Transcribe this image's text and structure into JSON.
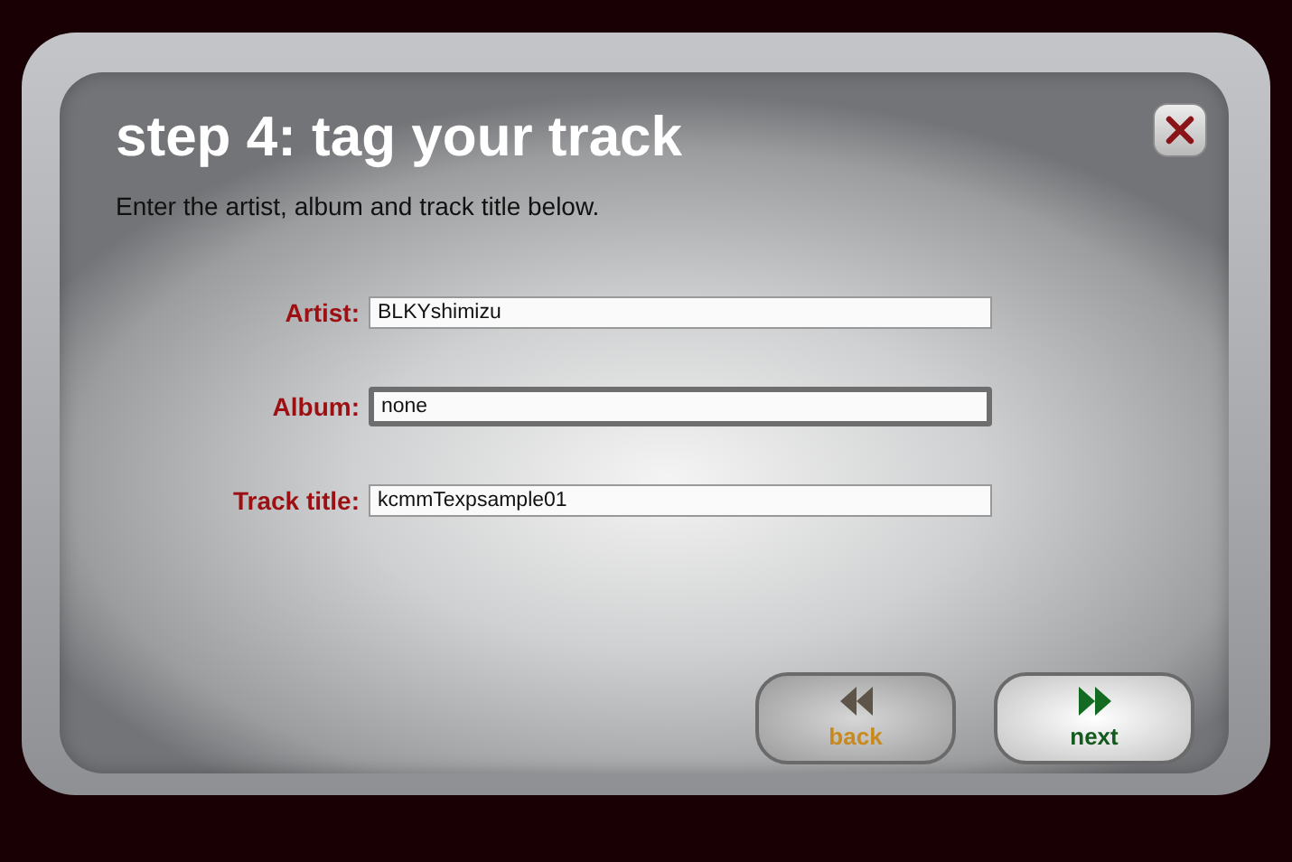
{
  "title": "step 4: tag your track",
  "instructions": "Enter the artist, album and track title below.",
  "fields": [
    {
      "label": "Artist:",
      "value": "BLKYshimizu",
      "focused": false
    },
    {
      "label": "Album:",
      "value": "none",
      "focused": true
    },
    {
      "label": "Track title:",
      "value": "kcmmTexpsample01",
      "focused": false
    }
  ],
  "buttons": [
    {
      "kind": "back",
      "label": "back"
    },
    {
      "kind": "next",
      "label": "next"
    }
  ]
}
